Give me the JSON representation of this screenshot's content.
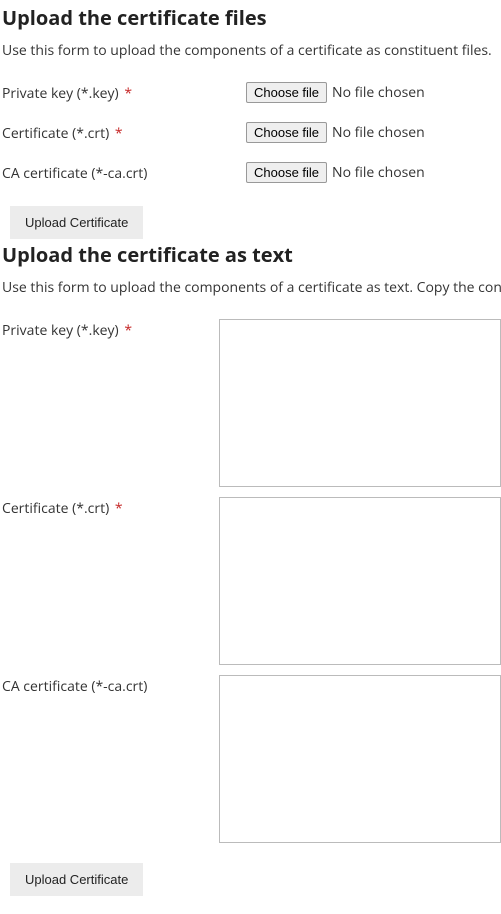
{
  "section1": {
    "heading": "Upload the certificate files",
    "description": "Use this form to upload the components of a certificate as constituent files.",
    "fields": {
      "private_key": {
        "label": "Private key (*.key)",
        "required": true,
        "button": "Choose file",
        "status": "No file chosen"
      },
      "certificate": {
        "label": "Certificate (*.crt)",
        "required": true,
        "button": "Choose file",
        "status": "No file chosen"
      },
      "ca_certificate": {
        "label": "CA certificate (*-ca.crt)",
        "required": false,
        "button": "Choose file",
        "status": "No file chosen"
      }
    },
    "submit_label": "Upload Certificate"
  },
  "section2": {
    "heading": "Upload the certificate as text",
    "description": "Use this form to upload the components of a certificate as text. Copy the con",
    "fields": {
      "private_key": {
        "label": "Private key (*.key)",
        "required": true,
        "value": ""
      },
      "certificate": {
        "label": "Certificate (*.crt)",
        "required": true,
        "value": ""
      },
      "ca_certificate": {
        "label": "CA certificate (*-ca.crt)",
        "required": false,
        "value": ""
      }
    },
    "submit_label": "Upload Certificate"
  },
  "required_marker": "*"
}
